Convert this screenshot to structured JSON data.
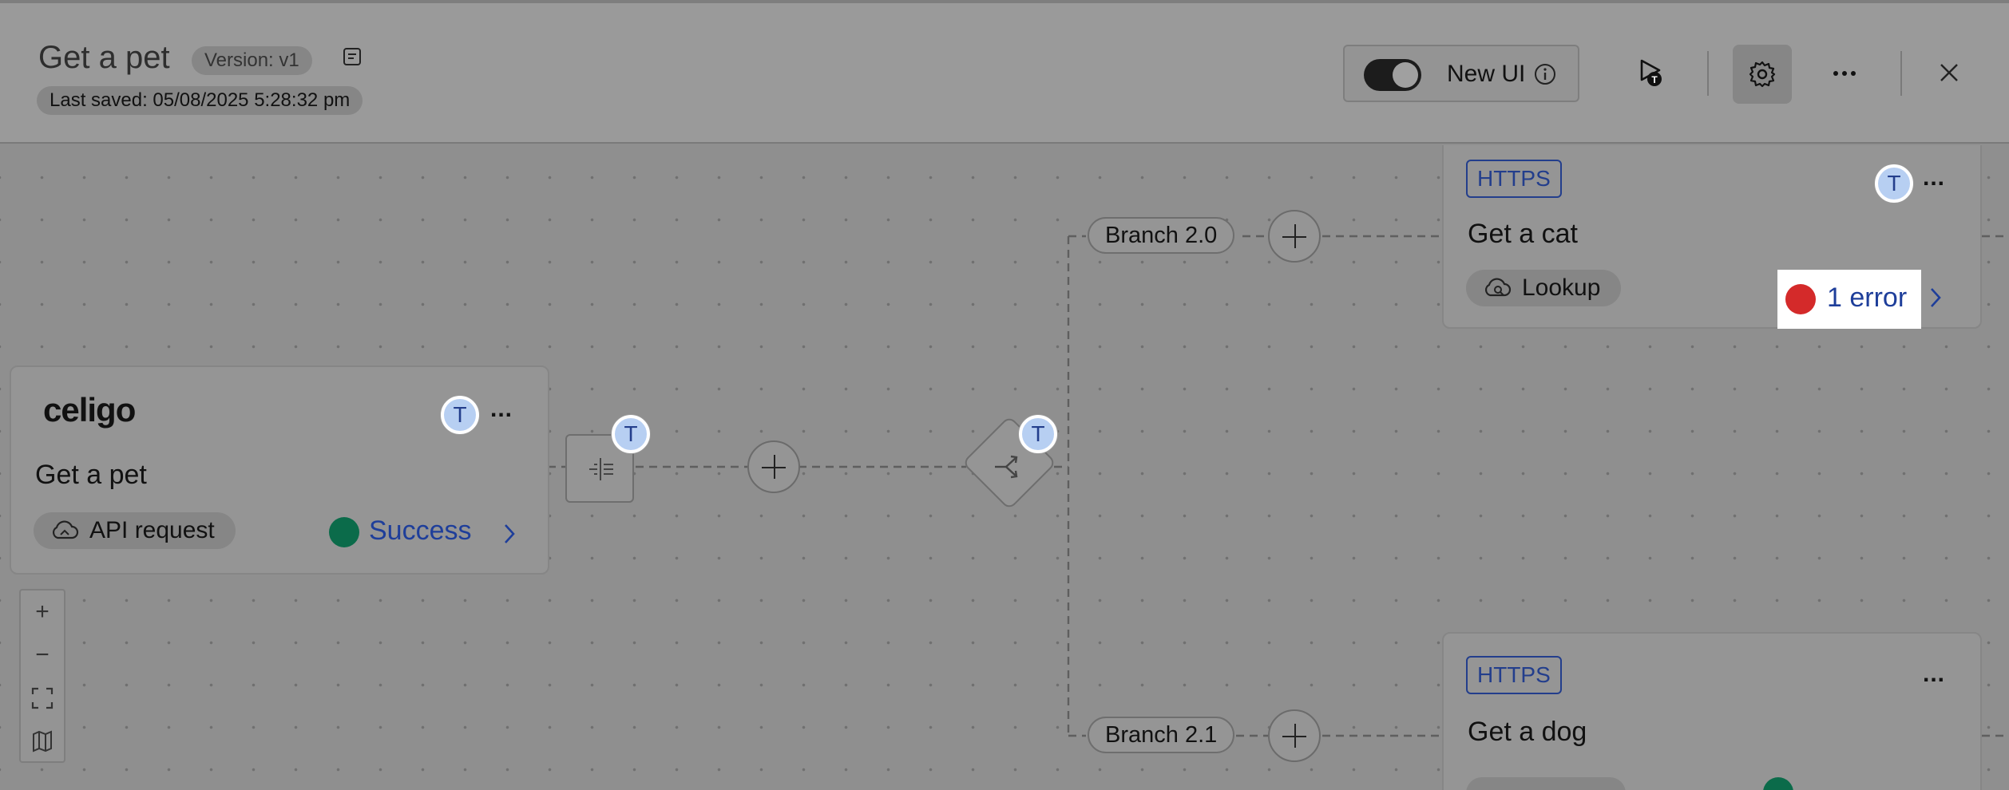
{
  "header": {
    "flow_title": "Get a pet",
    "version": "Version: v1",
    "last_saved": "Last saved: 05/08/2025 5:28:32 pm",
    "new_ui_label": "New UI",
    "new_ui_enabled": true
  },
  "icons": [
    "notes-icon",
    "info-icon",
    "run-test-icon",
    "gear-icon",
    "more-icon",
    "close-icon",
    "cloud-api-icon",
    "cloud-lookup-icon",
    "transform-icon",
    "branch-router-icon",
    "zoom-in-icon",
    "zoom-out-icon",
    "fit-view-icon",
    "map-icon"
  ],
  "source_card": {
    "logo": "celigo",
    "avatar": "T",
    "more": "...",
    "title": "Get a pet",
    "chip": "API request",
    "status": "Success",
    "status_color": "#0b6b4a"
  },
  "transform_node": {
    "avatar": "T"
  },
  "router_node": {
    "avatar": "T"
  },
  "branches": [
    {
      "label": "Branch 2.0"
    },
    {
      "label": "Branch 2.1"
    }
  ],
  "cat_card": {
    "badge": "HTTPS",
    "avatar": "T",
    "more": "...",
    "title": "Get a cat",
    "chip": "Lookup",
    "status": "1 error",
    "status_color": "#d42a2a"
  },
  "dog_card": {
    "badge": "HTTPS",
    "more": "...",
    "title": "Get a dog"
  },
  "zoom_controls": {
    "zoom_in": "+",
    "zoom_out": "−"
  },
  "colors": {
    "accent_blue": "#1e3e9a",
    "success": "#0b6b4a",
    "error": "#d42a2a"
  }
}
